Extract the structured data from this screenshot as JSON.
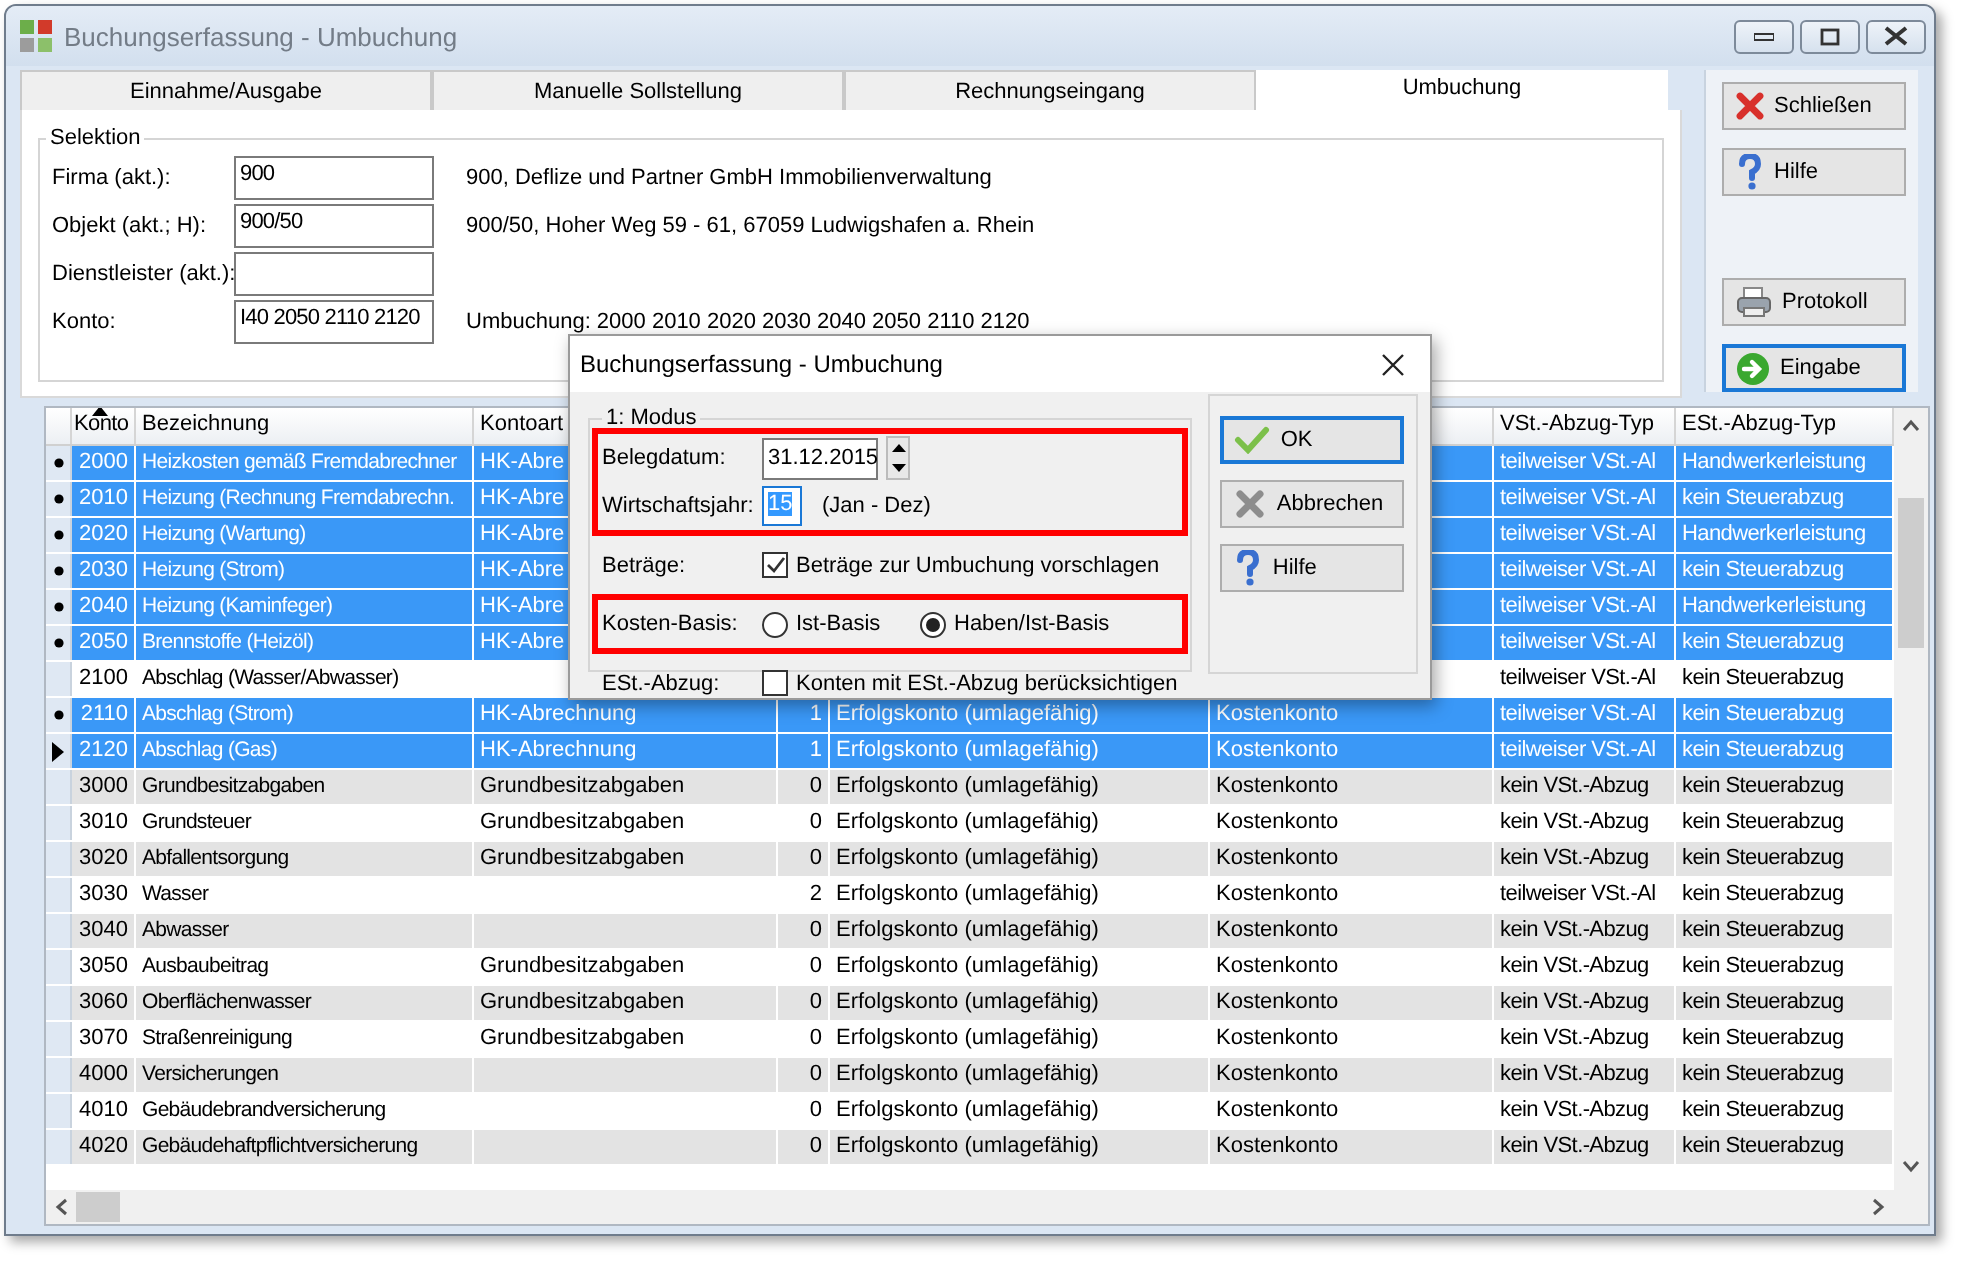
{
  "window": {
    "title": "Buchungserfassung - Umbuchung",
    "active": false
  },
  "tabs": [
    {
      "label": "Einnahme/Ausgabe",
      "selected": false
    },
    {
      "label": "Manuelle Sollstellung",
      "selected": false
    },
    {
      "label": "Rechnungseingang",
      "selected": false
    },
    {
      "label": "Umbuchung",
      "selected": true
    }
  ],
  "selection": {
    "title": "Selektion",
    "fields": [
      {
        "label": "Firma (akt.):",
        "value": "900",
        "description": "900,  Deflize und Partner GmbH Immobilienverwaltung"
      },
      {
        "label": "Objekt (akt.; H):",
        "value": "900/50",
        "description": "900/50,  Hoher Weg 59 - 61, 67059 Ludwigshafen a. Rhein"
      },
      {
        "label": "Dienstleister (akt.):"
      },
      {
        "label": "Konto:",
        "value": "I40 2050 2110 2120",
        "description": "Umbuchung: 2000 2010 2020 2030 2040 2050 2110 2120"
      }
    ]
  },
  "side_buttons": [
    {
      "label": "Schließen",
      "focused": false
    },
    {
      "label": "Hilfe",
      "focused": false
    },
    {
      "label": "Protokoll",
      "focused": false
    },
    {
      "label": "Eingabe",
      "focused": true
    }
  ],
  "table": {
    "columns": {
      "konto": "Konto",
      "bezeichnung": "Bezeichnung",
      "kontoart": "Kontoart",
      "vst": "VSt.-Abzug-Typ",
      "est": "ESt.-Abzug-Typ"
    },
    "sort_ascending": true,
    "rows": [
      {
        "marked": true,
        "current": false,
        "selected": true,
        "konto": "2000",
        "bezeichnung": "Heizkosten gemäß Fremdabrechner",
        "kontoart": "HK-Abre",
        "vst": "teilweiser VSt.-Al",
        "est": "Handwerkerleistung"
      },
      {
        "marked": true,
        "current": false,
        "selected": true,
        "konto": "2010",
        "bezeichnung": "Heizung (Rechnung Fremdabrechn.",
        "kontoart": "HK-Abre",
        "vst": "teilweiser VSt.-Al",
        "est": "kein Steuerabzug"
      },
      {
        "marked": true,
        "current": false,
        "selected": true,
        "konto": "2020",
        "bezeichnung": "Heizung (Wartung)",
        "kontoart": "HK-Abre",
        "vst": "teilweiser VSt.-Al",
        "est": "Handwerkerleistung"
      },
      {
        "marked": true,
        "current": false,
        "selected": true,
        "konto": "2030",
        "bezeichnung": "Heizung (Strom)",
        "kontoart": "HK-Abre",
        "vst": "teilweiser VSt.-Al",
        "est": "kein Steuerabzug"
      },
      {
        "marked": true,
        "current": false,
        "selected": true,
        "konto": "2040",
        "bezeichnung": "Heizung (Kaminfeger)",
        "kontoart": "HK-Abre",
        "vst": "teilweiser VSt.-Al",
        "est": "Handwerkerleistung"
      },
      {
        "marked": true,
        "current": false,
        "selected": true,
        "konto": "2050",
        "bezeichnung": "Brennstoffe (Heizöl)",
        "kontoart": "HK-Abre",
        "vst": "teilweiser VSt.-Al",
        "est": "kein Steuerabzug"
      },
      {
        "marked": false,
        "current": false,
        "selected": false,
        "konto": "2100",
        "bezeichnung": "Abschlag (Wasser/Abwasser)",
        "vst": "teilweiser VSt.-Al",
        "est": "kein Steuerabzug"
      },
      {
        "marked": true,
        "current": false,
        "selected": true,
        "konto": "2110",
        "bezeichnung": "Abschlag (Strom)",
        "kontoart": "HK-Abrechnung",
        "column_4": "1",
        "column_5": "Erfolgskonto (umlagefähig)",
        "column_6": "Kostenkonto",
        "vst": "teilweiser VSt.-Al",
        "est": "kein Steuerabzug"
      },
      {
        "marked": false,
        "current": true,
        "selected": true,
        "konto": "2120",
        "bezeichnung": "Abschlag (Gas)",
        "kontoart": "HK-Abrechnung",
        "column_4": "1",
        "column_5": "Erfolgskonto (umlagefähig)",
        "column_6": "Kostenkonto",
        "vst": "teilweiser VSt.-Al",
        "est": "kein Steuerabzug"
      },
      {
        "marked": false,
        "current": false,
        "selected": false,
        "konto": "3000",
        "bezeichnung": "Grundbesitzabgaben",
        "kontoart": "Grundbesitzabgaben",
        "column_4": "0",
        "column_5": "Erfolgskonto (umlagefähig)",
        "column_6": "Kostenkonto",
        "vst": "kein VSt.-Abzug",
        "est": "kein Steuerabzug"
      },
      {
        "marked": false,
        "current": false,
        "selected": false,
        "konto": "3010",
        "bezeichnung": "Grundsteuer",
        "kontoart": "Grundbesitzabgaben",
        "column_4": "0",
        "column_5": "Erfolgskonto (umlagefähig)",
        "column_6": "Kostenkonto",
        "vst": "kein VSt.-Abzug",
        "est": "kein Steuerabzug"
      },
      {
        "marked": false,
        "current": false,
        "selected": false,
        "konto": "3020",
        "bezeichnung": "Abfallentsorgung",
        "kontoart": "Grundbesitzabgaben",
        "column_4": "0",
        "column_5": "Erfolgskonto (umlagefähig)",
        "column_6": "Kostenkonto",
        "vst": "kein VSt.-Abzug",
        "est": "kein Steuerabzug"
      },
      {
        "marked": false,
        "current": false,
        "selected": false,
        "konto": "3030",
        "bezeichnung": "Wasser",
        "column_4": "2",
        "column_5": "Erfolgskonto (umlagefähig)",
        "column_6": "Kostenkonto",
        "vst": "teilweiser VSt.-Al",
        "est": "kein Steuerabzug"
      },
      {
        "marked": false,
        "current": false,
        "selected": false,
        "konto": "3040",
        "bezeichnung": "Abwasser",
        "column_4": "0",
        "column_5": "Erfolgskonto (umlagefähig)",
        "column_6": "Kostenkonto",
        "vst": "kein VSt.-Abzug",
        "est": "kein Steuerabzug"
      },
      {
        "marked": false,
        "current": false,
        "selected": false,
        "konto": "3050",
        "bezeichnung": "Ausbaubeitrag",
        "kontoart": "Grundbesitzabgaben",
        "column_4": "0",
        "column_5": "Erfolgskonto (umlagefähig)",
        "column_6": "Kostenkonto",
        "vst": "kein VSt.-Abzug",
        "est": "kein Steuerabzug"
      },
      {
        "marked": false,
        "current": false,
        "selected": false,
        "konto": "3060",
        "bezeichnung": "Oberflächenwasser",
        "kontoart": "Grundbesitzabgaben",
        "column_4": "0",
        "column_5": "Erfolgskonto (umlagefähig)",
        "column_6": "Kostenkonto",
        "vst": "kein VSt.-Abzug",
        "est": "kein Steuerabzug"
      },
      {
        "marked": false,
        "current": false,
        "selected": false,
        "konto": "3070",
        "bezeichnung": "Straßenreinigung",
        "kontoart": "Grundbesitzabgaben",
        "column_4": "0",
        "column_5": "Erfolgskonto (umlagefähig)",
        "column_6": "Kostenkonto",
        "vst": "kein VSt.-Abzug",
        "est": "kein Steuerabzug"
      },
      {
        "marked": false,
        "current": false,
        "selected": false,
        "konto": "4000",
        "bezeichnung": "Versicherungen",
        "column_4": "0",
        "column_5": "Erfolgskonto (umlagefähig)",
        "column_6": "Kostenkonto",
        "vst": "kein VSt.-Abzug",
        "est": "kein Steuerabzug"
      },
      {
        "marked": false,
        "current": false,
        "selected": false,
        "konto": "4010",
        "bezeichnung": "Gebäudebrandversicherung",
        "column_4": "0",
        "column_5": "Erfolgskonto (umlagefähig)",
        "column_6": "Kostenkonto",
        "vst": "kein VSt.-Abzug",
        "est": "kein Steuerabzug"
      },
      {
        "marked": false,
        "current": false,
        "selected": false,
        "konto": "4020",
        "bezeichnung": "Gebäudehaftpflichtversicherung",
        "column_4": "0",
        "column_5": "Erfolgskonto (umlagefähig)",
        "column_6": "Kostenkonto",
        "vst": "kein VSt.-Abzug",
        "est": "kein Steuerabzug"
      }
    ]
  },
  "dialog": {
    "title": "Buchungserfassung - Umbuchung",
    "group_title": "1: Modus",
    "sections": [
      {
        "highlighted": true,
        "rows": [
          {
            "kind": "date",
            "label": "Belegdatum:",
            "value": "31.12.2015"
          },
          {
            "kind": "year",
            "label": "Wirtschaftsjahr:",
            "value": "15",
            "value_selected": true,
            "note": "(Jan - Dez)"
          }
        ]
      },
      {
        "highlighted": false,
        "rows": [
          {
            "kind": "checkbox",
            "label": "Beträge:",
            "text": "Beträge zur Umbuchung vorschlagen",
            "checked": true
          }
        ]
      },
      {
        "highlighted": true,
        "rows": [
          {
            "kind": "radio",
            "label": "Kosten-Basis:",
            "options": [
              {
                "label": "Ist-Basis",
                "selected": false
              },
              {
                "label": "Haben/Ist-Basis",
                "selected": true
              }
            ]
          }
        ]
      },
      {
        "highlighted": false,
        "rows": [
          {
            "kind": "checkbox",
            "label": "ESt.-Abzug:",
            "text": "Konten mit ESt.-Abzug berücksichtigen",
            "checked": false
          }
        ]
      }
    ],
    "buttons": [
      {
        "label": "OK",
        "focused": true
      },
      {
        "label": "Abbrechen",
        "focused": false
      },
      {
        "label": "Hilfe",
        "focused": false
      }
    ]
  }
}
